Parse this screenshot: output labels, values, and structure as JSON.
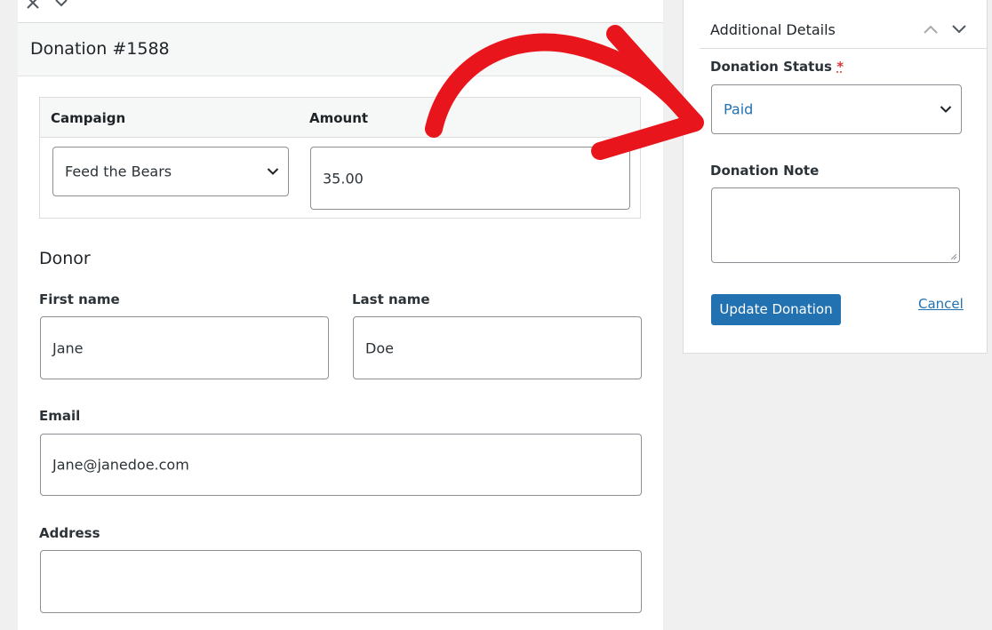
{
  "header": {
    "title": "Donation #1588"
  },
  "campaign_table": {
    "campaign_header": "Campaign",
    "amount_header": "Amount",
    "campaign_value": "Feed the Bears",
    "amount_value": "35.00"
  },
  "donor": {
    "section_title": "Donor",
    "first_name_label": "First name",
    "first_name_value": "Jane",
    "last_name_label": "Last name",
    "last_name_value": "Doe",
    "email_label": "Email",
    "email_value": "Jane@janedoe.com",
    "address_label": "Address",
    "address_value": ""
  },
  "details": {
    "title": "Additional Details",
    "status_label": "Donation Status",
    "required_marker": "*",
    "status_value": "Paid",
    "note_label": "Donation Note",
    "note_value": "",
    "update_button": "Update Donation",
    "cancel_link": "Cancel"
  },
  "colors": {
    "accent": "#2271b1",
    "annotation_arrow": "#e8161c",
    "required": "#d63638"
  },
  "icons": [
    "close-icon",
    "chevron-down-icon",
    "chevron-up-icon",
    "resize-handle-icon",
    "arrow-annotation"
  ]
}
